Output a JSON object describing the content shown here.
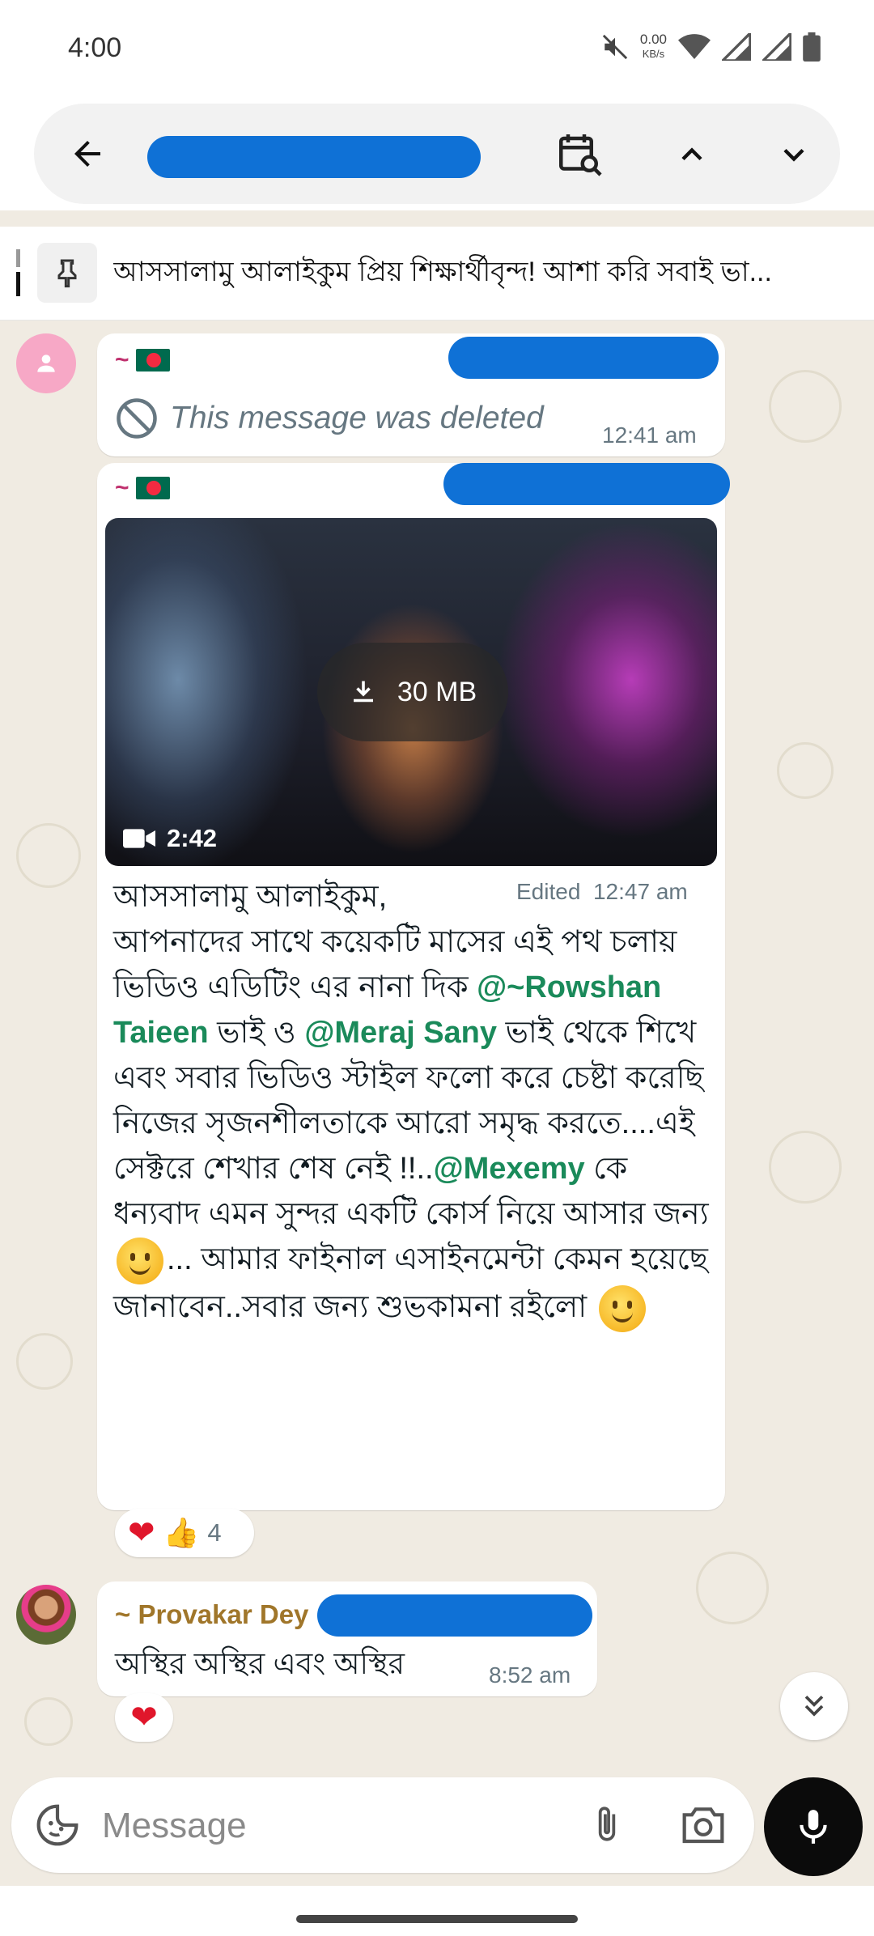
{
  "status_bar": {
    "time": "4:00",
    "net_speed_value": "0.00",
    "net_speed_unit": "KB/s"
  },
  "search_header": {
    "query": "redacted"
  },
  "pinned": {
    "text": "আসসালামু আলাইকুম প্রিয় শিক্ষার্থীবৃন্দ! আশা করি সবাই ভা..."
  },
  "messages": [
    {
      "sender_prefix": "~",
      "deleted_text": "This message was deleted",
      "time": "12:41 am"
    },
    {
      "sender_prefix": "~",
      "video_size": "30 MB",
      "video_duration": "2:42",
      "edited_label": "Edited",
      "time": "12:47 am",
      "caption_1": "আসসালামু আলাইকুম,",
      "caption_2": "আপনাদের সাথে কয়েকটি মাসের এই পথ চলায় ভিডিও এডিটিং এর নানা দিক ",
      "mention_1": "@~Rowshan Taieen",
      "caption_3": "  ভাই ও ",
      "mention_2": "@Meraj Sany",
      "caption_4": "  ভাই থেকে শিখে এবং সবার ভিডিও স্টাইল ফলো করে চেষ্টা করেছি নিজের সৃজনশীলতাকে আরো সমৃদ্ধ করতে....এই সেক্টরে শেখার শেষ নেই !!..",
      "mention_3": "@Mexemy",
      "caption_5": " কে ধন্যবাদ এমন সুন্দর একটি কোর্স নিয়ে আসার জন্য ",
      "caption_6": "... আমার ফাইনাল এসাইনমেন্টা কেমন হয়েছে জানাবেন..সবার জন্য শুভকামনা রইলো ",
      "reaction_count": "4"
    },
    {
      "sender": "~ Provakar Dey",
      "text": "অস্থির অস্থির এবং অস্থির",
      "time": "8:52 am"
    }
  ],
  "input": {
    "placeholder": "Message"
  }
}
